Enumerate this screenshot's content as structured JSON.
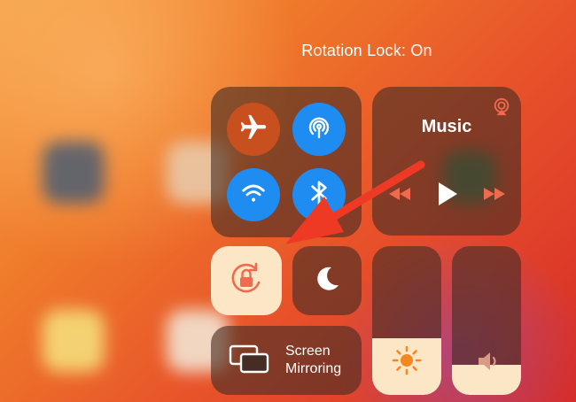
{
  "status": {
    "rotation_lock_text": "Rotation Lock: On"
  },
  "connectivity": {
    "airplane": {
      "icon": "airplane-icon",
      "on": true,
      "color": "#e5541f"
    },
    "airdrop": {
      "icon": "airdrop-icon",
      "on": true,
      "color": "#1e90ff"
    },
    "wifi": {
      "icon": "wifi-icon",
      "on": true,
      "color": "#1e90ff"
    },
    "bluetooth": {
      "icon": "bluetooth-icon",
      "on": true,
      "color": "#1e90ff"
    }
  },
  "music": {
    "title": "Music",
    "airplay_icon": "airplay-icon",
    "controls": [
      "rewind-icon",
      "play-icon",
      "fast-forward-icon"
    ]
  },
  "toggles": {
    "rotation_lock": {
      "icon": "rotation-lock-icon",
      "on": true,
      "color": "#fbe6c6",
      "icon_color": "#f06a4f"
    },
    "do_not_disturb": {
      "icon": "moon-icon",
      "on": false
    }
  },
  "screen_mirroring": {
    "label": "Screen\nMirroring",
    "icon": "screen-mirroring-icon"
  },
  "sliders": {
    "brightness": {
      "icon": "sun-icon",
      "level": 0.38,
      "icon_color": "#f5871f"
    },
    "volume": {
      "icon": "speaker-icon",
      "level": 0.2,
      "icon_color": "#d99a86"
    }
  },
  "annotation": {
    "arrow_color": "#ee3a24"
  }
}
